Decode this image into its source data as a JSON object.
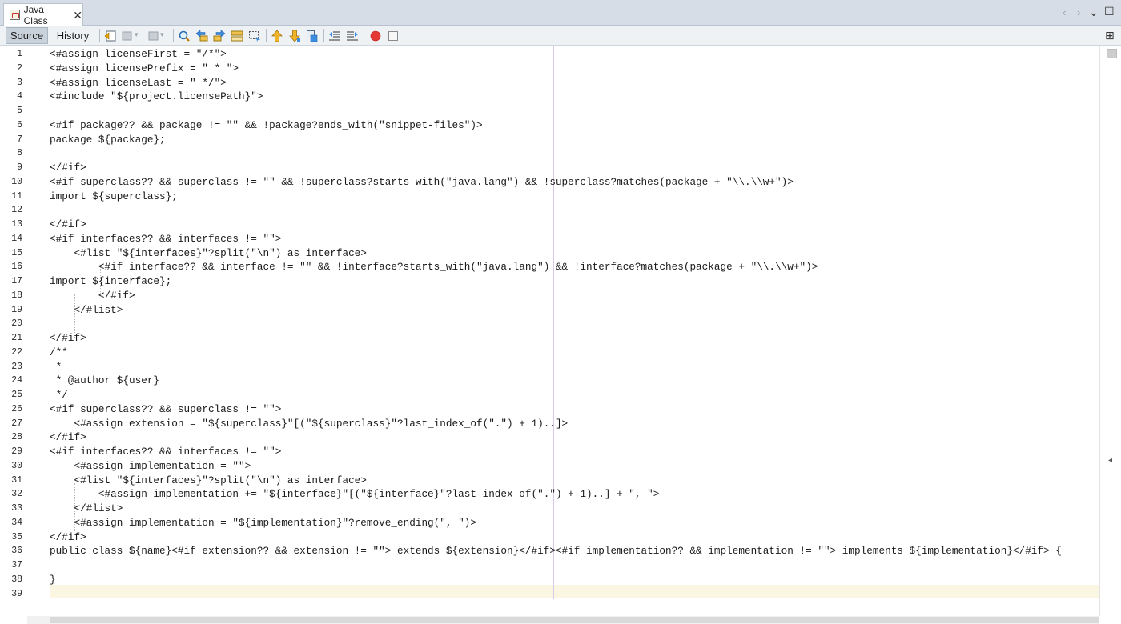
{
  "tab": {
    "title": "Java Class",
    "close": "✕"
  },
  "tab_nav": {
    "prev": "‹",
    "next": "›",
    "menu": "⌄",
    "restore": "☐"
  },
  "toolbar": {
    "source_label": "Source",
    "history_label": "History",
    "layout_glyph": "⊞"
  },
  "editor": {
    "line_numbers": [
      "1",
      "2",
      "3",
      "4",
      "5",
      "6",
      "7",
      "8",
      "9",
      "10",
      "11",
      "12",
      "13",
      "14",
      "15",
      "16",
      "17",
      "18",
      "19",
      "20",
      "21",
      "22",
      "23",
      "24",
      "25",
      "26",
      "27",
      "28",
      "29",
      "30",
      "31",
      "32",
      "33",
      "34",
      "35",
      "36",
      "37",
      "38",
      "39"
    ],
    "lines": [
      "<#assign licenseFirst = \"/*\">",
      "<#assign licensePrefix = \" * \">",
      "<#assign licenseLast = \" */\">",
      "<#include \"${project.licensePath}\">",
      "",
      "<#if package?? && package != \"\" && !package?ends_with(\"snippet-files\")>",
      "package ${package};",
      "",
      "</#if>",
      "<#if superclass?? && superclass != \"\" && !superclass?starts_with(\"java.lang\") && !superclass?matches(package + \"\\\\.\\\\w+\")>",
      "import ${superclass};",
      "",
      "</#if>",
      "<#if interfaces?? && interfaces != \"\">",
      "    <#list \"${interfaces}\"?split(\"\\n\") as interface>",
      "        <#if interface?? && interface != \"\" && !interface?starts_with(\"java.lang\") && !interface?matches(package + \"\\\\.\\\\w+\")>",
      "import ${interface};",
      "        </#if>",
      "    </#list>",
      "",
      "</#if>",
      "/**",
      " *",
      " * @author ${user}",
      " */",
      "<#if superclass?? && superclass != \"\">",
      "    <#assign extension = \"${superclass}\"[(\"${superclass}\"?last_index_of(\".\") + 1)..]>",
      "</#if>",
      "<#if interfaces?? && interfaces != \"\">",
      "    <#assign implementation = \"\">",
      "    <#list \"${interfaces}\"?split(\"\\n\") as interface>",
      "        <#assign implementation += \"${interface}\"[(\"${interface}\"?last_index_of(\".\") + 1)..] + \", \">",
      "    </#list>",
      "    <#assign implementation = \"${implementation}\"?remove_ending(\", \")>",
      "</#if>",
      "public class ${name}<#if extension?? && extension != \"\"> extends ${extension}</#if><#if implementation?? && implementation != \"\"> implements ${implementation}</#if> {",
      "",
      "}",
      ""
    ]
  },
  "scrollbar": {
    "marker": "◂"
  },
  "colors": {
    "tab_bg": "#d6dde6",
    "toolbar_bg": "#eff2f5",
    "current_line": "#fbf6e2",
    "margin_guide": "#d9c8e8"
  },
  "icons": [
    "last-edit-icon",
    "back-icon",
    "forward-icon",
    "find-selection-icon",
    "find-previous-icon",
    "find-next-icon",
    "toggle-highlight-icon",
    "toggle-rect-selection-icon",
    "previous-bookmark-icon",
    "next-bookmark-icon",
    "toggle-bookmark-icon",
    "shift-left-icon",
    "shift-right-icon",
    "start-macro-icon",
    "stop-macro-icon",
    "split-layout-icon"
  ]
}
